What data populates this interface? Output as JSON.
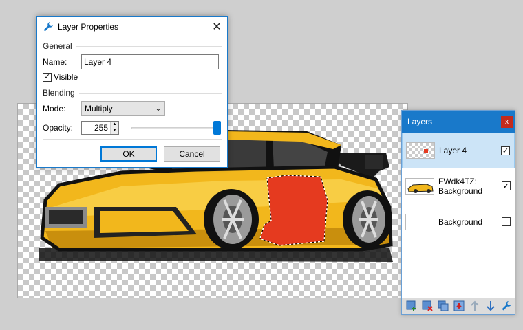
{
  "dialog": {
    "title": "Layer Properties",
    "close_icon": "close-icon",
    "general_heading": "General",
    "name_label": "Name:",
    "name_value": "Layer 4",
    "visible_label": "Visible",
    "visible_checked": true,
    "blending_heading": "Blending",
    "mode_label": "Mode:",
    "mode_value": "Multiply",
    "opacity_label": "Opacity:",
    "opacity_value": "255",
    "opacity_fraction": 1.0,
    "ok_label": "OK",
    "cancel_label": "Cancel"
  },
  "layers_panel": {
    "title": "Layers",
    "close_label": "x",
    "items": [
      {
        "name": "Layer 4",
        "visible": true,
        "selected": true
      },
      {
        "name": "FWdk4TZ: Background",
        "visible": true,
        "selected": false
      },
      {
        "name": "Background",
        "visible": false,
        "selected": false
      }
    ],
    "toolbar_icons": [
      "add-layer-icon",
      "delete-layer-icon",
      "duplicate-layer-icon",
      "merge-down-icon",
      "move-up-icon",
      "move-down-icon",
      "layer-properties-icon"
    ]
  },
  "colors": {
    "accent": "#1979ca",
    "car_yellow": "#f2b71c",
    "selection_red": "#e53a1f"
  }
}
